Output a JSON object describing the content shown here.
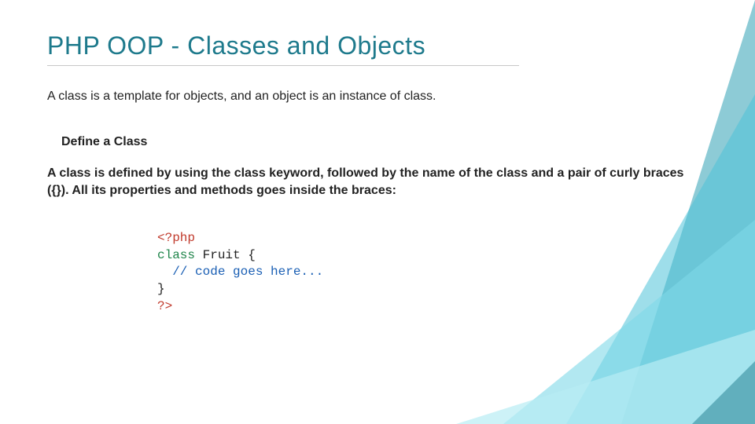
{
  "title": "PHP OOP - Classes and Objects",
  "intro": "A class is a template for objects, and an object is an instance of class.",
  "section_heading": "Define a Class",
  "section_text": "A class is defined by using the class keyword, followed by the name of the class and a pair of curly braces ({}). All its properties and methods goes inside the braces:",
  "code": {
    "l1": "<?php",
    "l2a": "class",
    "l2b": " Fruit {",
    "l3": "  // code goes here...",
    "l4": "}",
    "l5": "?>"
  }
}
